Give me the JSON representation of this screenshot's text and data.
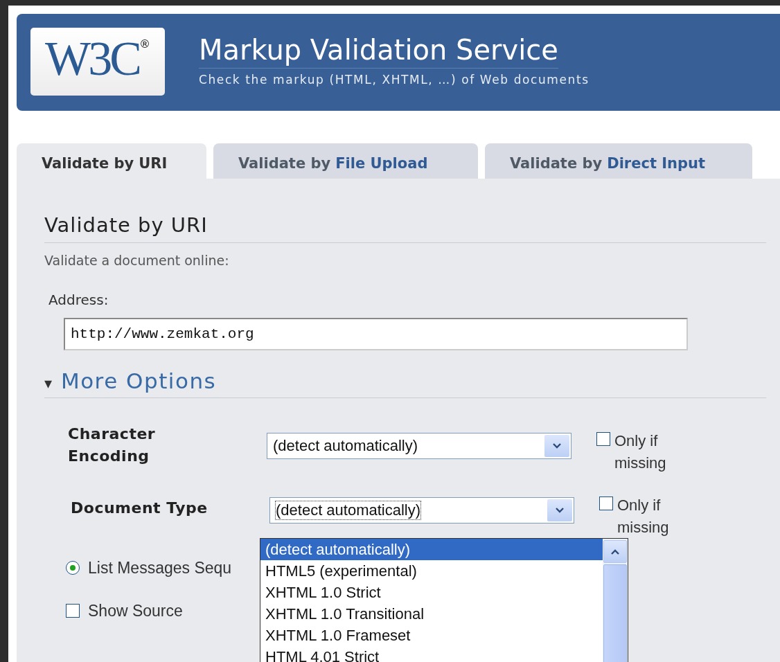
{
  "header": {
    "logo": {
      "text": "W3C",
      "mark": "®"
    },
    "title": "Markup Validation Service",
    "subtitle": "Check the markup (HTML, XHTML, …) of Web documents"
  },
  "tabs": [
    {
      "prefix": "Validate by",
      "emphasis": "URI",
      "selected": true
    },
    {
      "prefix": "Validate by",
      "emphasis": "File Upload",
      "selected": false
    },
    {
      "prefix": "Validate by",
      "emphasis": "Direct Input",
      "selected": false
    }
  ],
  "panel": {
    "heading": "Validate by URI",
    "intro": "Validate a document online:",
    "address_label": "Address:",
    "address_value": "http://www.zemkat.org",
    "more_options": {
      "toggle": "▾",
      "label": "More Options",
      "expanded": true
    },
    "options": [
      {
        "label": "Character Encoding",
        "value": "(detect automatically)",
        "focused": false,
        "only_if_missing": {
          "label": "Only if missing",
          "checked": false
        }
      },
      {
        "label": "Document Type",
        "value": "(detect automatically)",
        "focused": true,
        "only_if_missing": {
          "label": "Only if missing",
          "checked": false
        }
      }
    ],
    "toggles": [
      {
        "kind": "radio",
        "label": "List Messages Sequ",
        "checked": true
      },
      {
        "kind": "checkbox",
        "label": "Show Source",
        "checked": false
      }
    ],
    "dropdown": {
      "items": [
        {
          "label": "(detect automatically)",
          "selected": true
        },
        {
          "label": "HTML5 (experimental)",
          "selected": false
        },
        {
          "label": "XHTML 1.0 Strict",
          "selected": false
        },
        {
          "label": "XHTML 1.0 Transitional",
          "selected": false
        },
        {
          "label": "XHTML 1.0 Frameset",
          "selected": false
        },
        {
          "label": "HTML 4.01 Strict",
          "selected": false
        }
      ]
    }
  }
}
